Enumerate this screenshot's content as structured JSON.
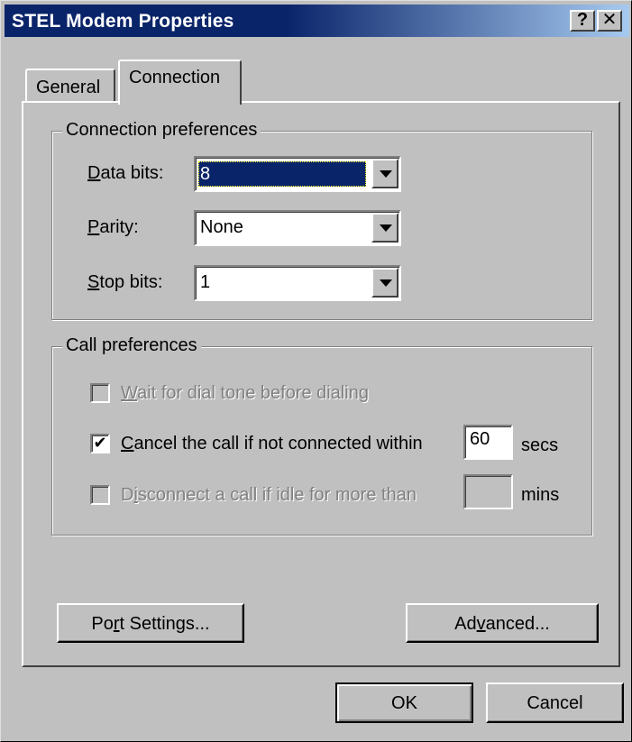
{
  "window": {
    "title": "STEL Modem Properties",
    "help_label": "?",
    "close_label": "✕"
  },
  "tabs": [
    {
      "label": "General",
      "active": false
    },
    {
      "label": "Connection",
      "active": true
    }
  ],
  "connection_preferences": {
    "legend": "Connection preferences",
    "data_bits": {
      "label_accel": "D",
      "label_rest": "ata bits:",
      "value": "8"
    },
    "parity": {
      "label_accel": "P",
      "label_rest": "arity:",
      "value": "None"
    },
    "stop_bits": {
      "label_accel": "S",
      "label_rest": "top bits:",
      "value": "1"
    }
  },
  "call_preferences": {
    "legend": "Call preferences",
    "wait_dial_tone": {
      "accel": "W",
      "rest": "ait for dial tone before dialing",
      "checked": false,
      "enabled": false
    },
    "cancel_call": {
      "accel": "C",
      "rest": "ancel the call if not connected within",
      "checked": true,
      "enabled": true,
      "value": "60",
      "unit": "secs"
    },
    "disconnect_idle": {
      "pre": "D",
      "accel": "i",
      "rest": "sconnect a call if idle for more than",
      "checked": false,
      "enabled": false,
      "value": "",
      "unit": "mins"
    }
  },
  "buttons": {
    "port_settings": {
      "pre": "Po",
      "accel": "r",
      "rest": "t Settings..."
    },
    "advanced": {
      "pre": "Ad",
      "accel": "v",
      "rest": "anced..."
    },
    "ok": "OK",
    "cancel": "Cancel"
  },
  "colors": {
    "title_bar": "#0a246a",
    "title_bar_end": "#a6caf0",
    "face": "#c0c0c0",
    "selection": "#0a246a"
  }
}
